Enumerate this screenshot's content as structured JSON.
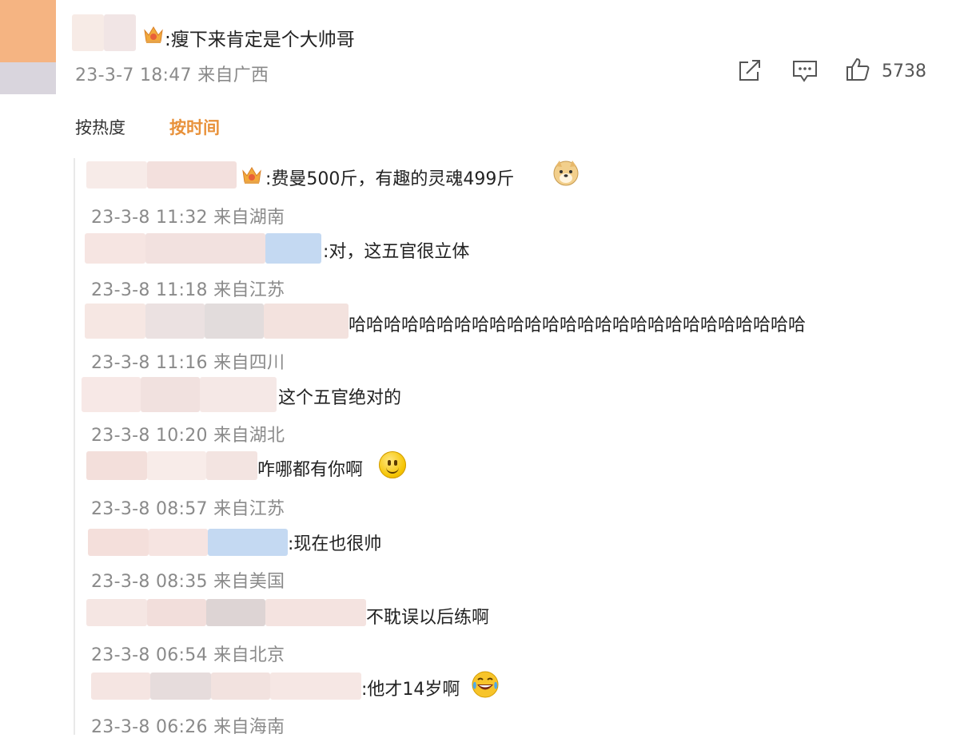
{
  "main_comment": {
    "text": ":瘦下来肯定是个大帅哥",
    "time": "23-3-7 18:47 来自广西",
    "like_count": "5738"
  },
  "icons": {
    "share": "share-icon",
    "comment": "comment-icon",
    "like": "thumbs-up-icon",
    "crown": "crown-badge-icon"
  },
  "sort": {
    "hot": "按热度",
    "time": "按时间",
    "active_color": "#e8913a"
  },
  "replies": [
    {
      "text": ":费曼500斤，有趣的灵魂499斤",
      "time": "23-3-8 11:32 来自湖南",
      "emoji": "dog-face-emoji"
    },
    {
      "text": ":对，这五官很立体",
      "time": "23-3-8 11:18 来自江苏"
    },
    {
      "text": "哈哈哈哈哈哈哈哈哈哈哈哈哈哈哈哈哈哈哈哈哈哈哈哈哈哈",
      "time": "23-3-8 11:16 来自四川"
    },
    {
      "text": "这个五官绝对的",
      "time": "23-3-8 10:20 来自湖北"
    },
    {
      "text": "咋哪都有你啊",
      "time": "23-3-8 08:57 来自江苏",
      "emoji": "smile-emoji"
    },
    {
      "text": ":现在也很帅",
      "time": "23-3-8 08:35 来自美国"
    },
    {
      "text": "不耽误以后练啊",
      "time": "23-3-8 06:54 来自北京"
    },
    {
      "text": ":他才14岁啊",
      "time": "23-3-8 06:26 来自海南",
      "emoji": "laugh-tears-emoji"
    }
  ]
}
